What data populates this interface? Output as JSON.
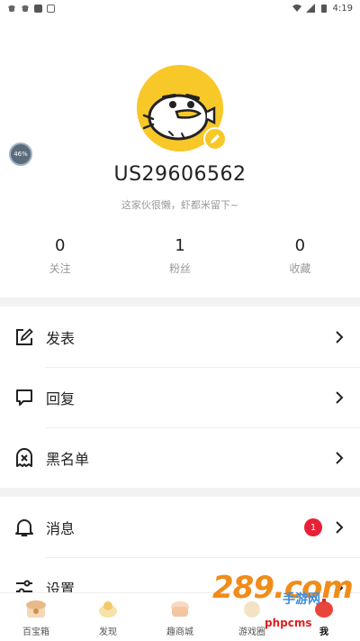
{
  "status_bar": {
    "time": "4:19",
    "left_icons": [
      "bug-icon",
      "bug-icon",
      "square-icon",
      "text-a-icon"
    ],
    "right_icons": [
      "wifi-icon",
      "signal-icon",
      "battery-icon"
    ]
  },
  "profile": {
    "username": "US29606562",
    "bio": "这家伙很懒，虾都米留下~",
    "progress_ball": "46%",
    "avatar_color": "#f8c829"
  },
  "stats": [
    {
      "value": "0",
      "label": "关注"
    },
    {
      "value": "1",
      "label": "粉丝"
    },
    {
      "value": "0",
      "label": "收藏"
    }
  ],
  "menu": {
    "post": "发表",
    "reply": "回复",
    "blacklist": "黑名单",
    "messages": "消息",
    "messages_badge": "1",
    "settings": "设置"
  },
  "bottom_nav": [
    {
      "label": "百宝箱",
      "icon": "treasure-box-icon"
    },
    {
      "label": "发现",
      "icon": "discover-icon"
    },
    {
      "label": "趣商城",
      "icon": "mall-icon"
    },
    {
      "label": "游戏圈",
      "icon": "game-circle-icon"
    },
    {
      "label": "我",
      "icon": "me-icon"
    }
  ],
  "watermark": {
    "big": "289.com",
    "sub": "手游网",
    "php": "phpcms"
  },
  "colors": {
    "accent": "#f8c829",
    "badge": "#e82036",
    "divider": "#f2f2f2"
  }
}
